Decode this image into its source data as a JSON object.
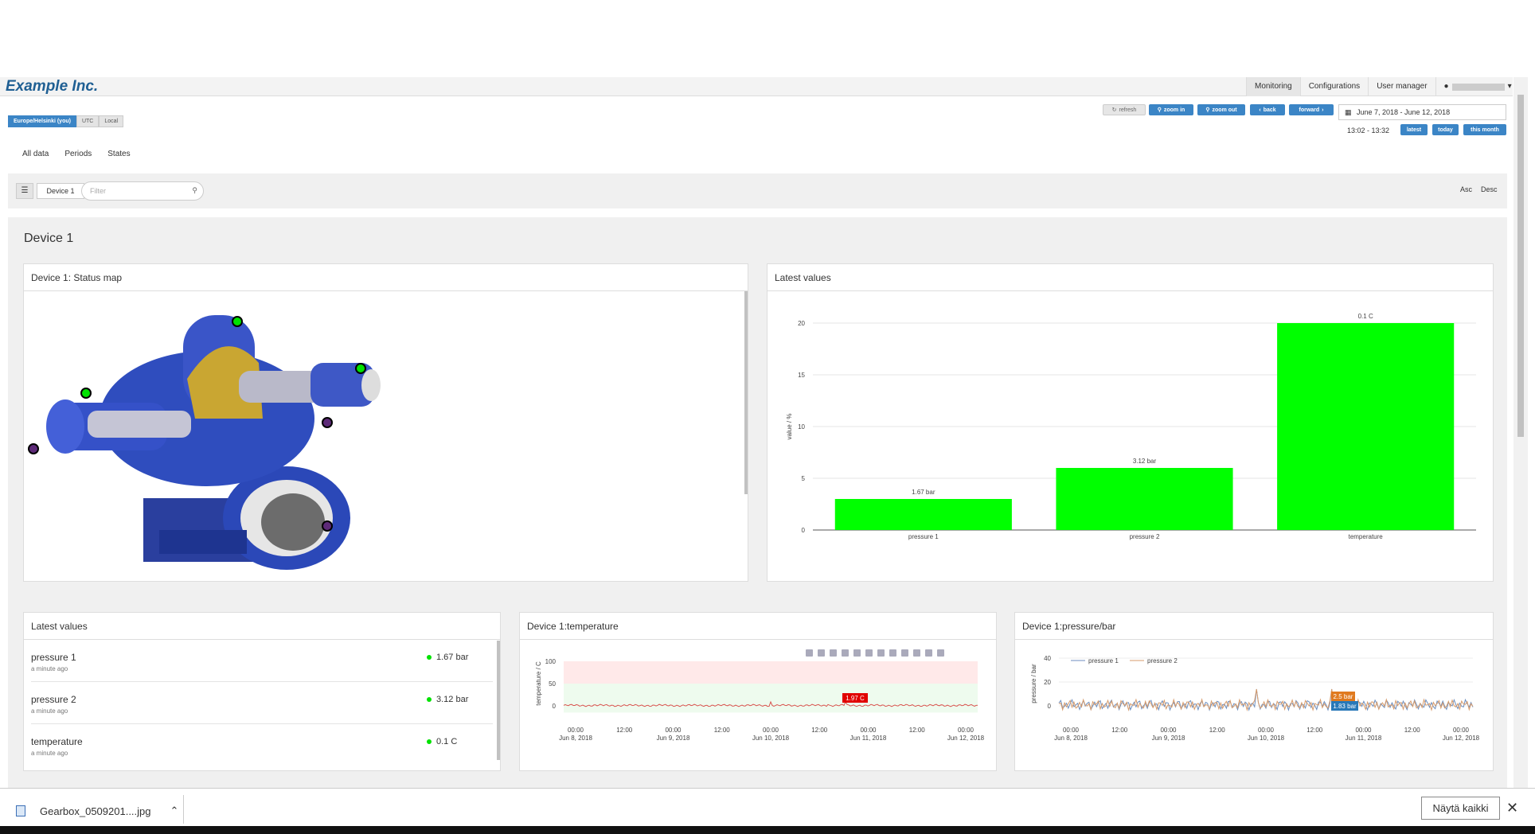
{
  "header": {
    "brand": "Example Inc.",
    "nav": [
      "Monitoring",
      "Configurations",
      "User manager"
    ],
    "user": ""
  },
  "timezone": {
    "options": [
      "Europe/Helsinki (you)",
      "UTC",
      "Local"
    ],
    "selected": 0
  },
  "toolbar": {
    "refresh": "refresh",
    "zoom_in": "zoom in",
    "zoom_out": "zoom out",
    "back": "back",
    "forward": "forward",
    "date_range": "June 7, 2018 - June 12, 2018",
    "time_range": "13:02 - 13:32",
    "latest": "latest",
    "today": "today",
    "this_month": "this month"
  },
  "subtabs": [
    "All data",
    "Periods",
    "States"
  ],
  "filter": {
    "device_chip": "Device 1",
    "placeholder": "Filter",
    "asc": "Asc",
    "desc": "Desc"
  },
  "device": {
    "title": "Device 1"
  },
  "status_map": {
    "title": "Device 1: Status map",
    "markers": [
      {
        "status": "ok"
      },
      {
        "status": "ok"
      },
      {
        "status": "ok"
      },
      {
        "status": "off"
      },
      {
        "status": "off"
      },
      {
        "status": "off"
      }
    ]
  },
  "latest_values_chart": {
    "title": "Latest values"
  },
  "latest_values_list": {
    "title": "Latest values",
    "items": [
      {
        "name": "pressure 1",
        "time": "a minute ago",
        "value": "1.67 bar"
      },
      {
        "name": "pressure 2",
        "time": "a minute ago",
        "value": "3.12 bar"
      },
      {
        "name": "temperature",
        "time": "a minute ago",
        "value": "0.1 C"
      }
    ]
  },
  "temp_chart": {
    "title": "Device 1:temperature",
    "tooltip": "1.97 C"
  },
  "pressure_chart": {
    "title": "Device 1:pressure/bar",
    "tooltip1": "2.5 bar",
    "tooltip2": "1.83 bar"
  },
  "download": {
    "filename": "Gearbox_0509201....jpg",
    "show_all": "Näytä kaikki"
  },
  "chart_data": [
    {
      "type": "bar",
      "title": "",
      "categories": [
        "pressure 1",
        "pressure 2",
        "temperature"
      ],
      "values": [
        3,
        6,
        20
      ],
      "labels": [
        "1.67 bar",
        "3.12 bar",
        "0.1 C"
      ],
      "ylabel": "value / %",
      "ylim": [
        0,
        20
      ],
      "yticks": [
        0,
        5,
        10,
        15,
        20
      ],
      "color": "#00ff00"
    },
    {
      "type": "line",
      "ylabel": "temperature / C",
      "ylim": [
        0,
        100
      ],
      "yticks": [
        0,
        50,
        100
      ],
      "xticks": [
        [
          "00:00",
          "Jun 8, 2018"
        ],
        [
          "12:00",
          ""
        ],
        [
          "00:00",
          "Jun 9, 2018"
        ],
        [
          "12:00",
          ""
        ],
        [
          "00:00",
          "Jun 10, 2018"
        ],
        [
          "12:00",
          ""
        ],
        [
          "00:00",
          "Jun 11, 2018"
        ],
        [
          "12:00",
          ""
        ],
        [
          "00:00",
          "Jun 12, 2018"
        ]
      ],
      "color": "#d9534f"
    },
    {
      "type": "line",
      "ylabel": "pressure / bar",
      "ylim": [
        0,
        40
      ],
      "yticks": [
        0,
        20,
        40
      ],
      "legend": "top-left",
      "series": [
        {
          "name": "pressure 1",
          "color": "#6c8ebf"
        },
        {
          "name": "pressure 2",
          "color": "#d79b6b"
        }
      ],
      "xticks": [
        [
          "00:00",
          "Jun 8, 2018"
        ],
        [
          "12:00",
          ""
        ],
        [
          "00:00",
          "Jun 9, 2018"
        ],
        [
          "12:00",
          ""
        ],
        [
          "00:00",
          "Jun 10, 2018"
        ],
        [
          "12:00",
          ""
        ],
        [
          "00:00",
          "Jun 11, 2018"
        ],
        [
          "12:00",
          ""
        ],
        [
          "00:00",
          "Jun 12, 2018"
        ]
      ]
    }
  ]
}
